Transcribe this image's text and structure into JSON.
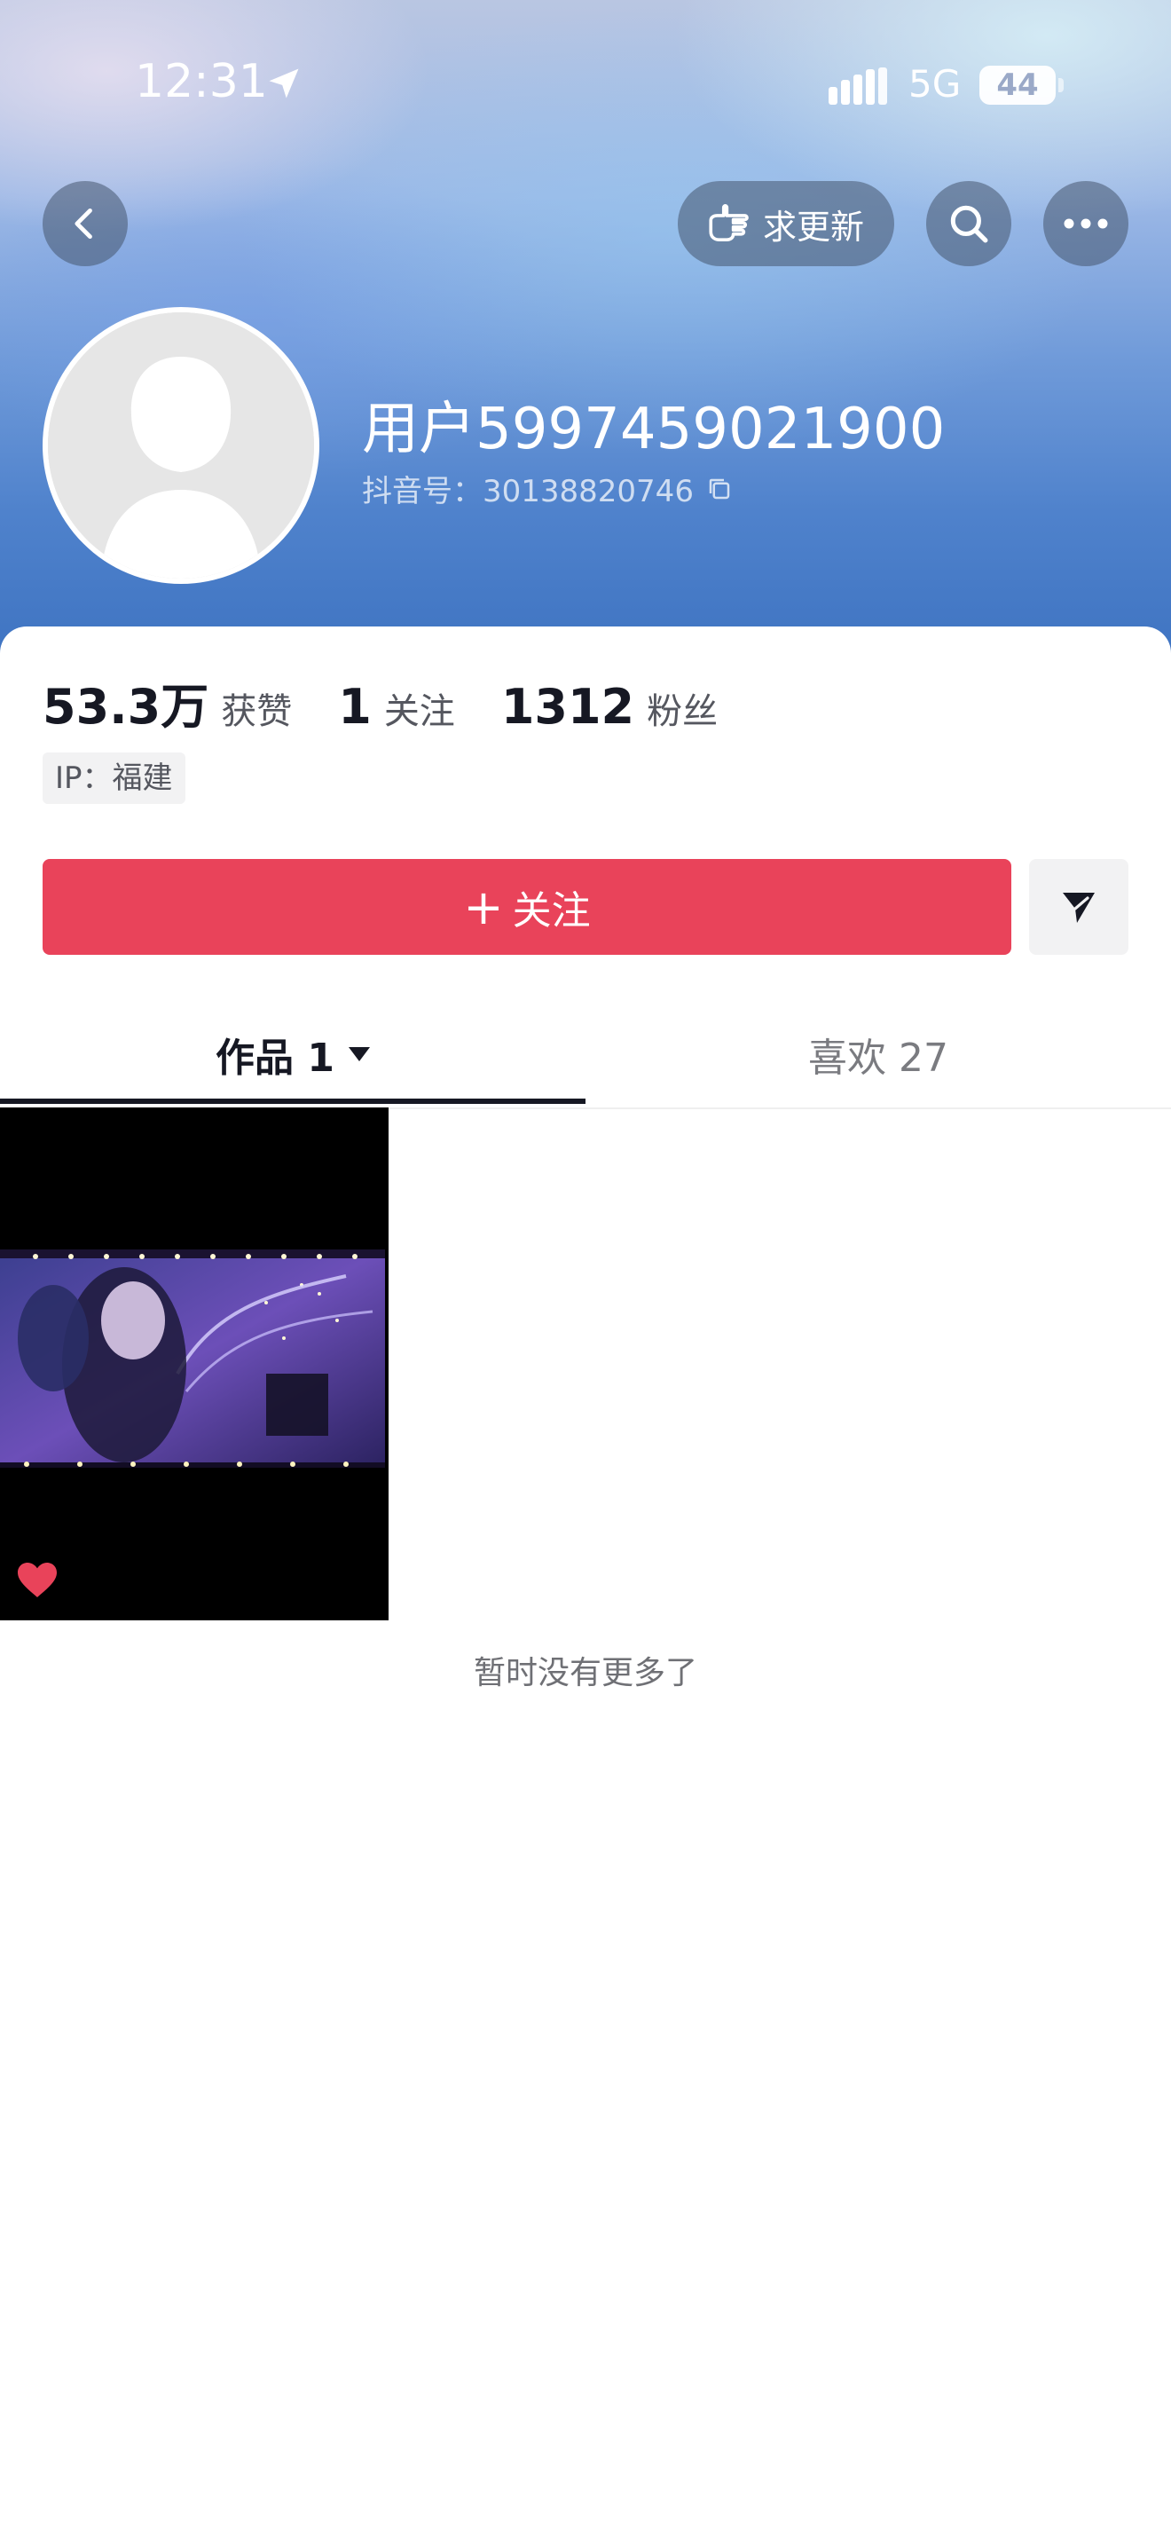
{
  "status_bar": {
    "time": "12:31",
    "network": "5G",
    "battery": "44"
  },
  "header": {
    "update_label": "求更新",
    "username": "用户5997459021900",
    "douyin_id": "抖音号：30138820746"
  },
  "stats": [
    {
      "value": "53.3万",
      "label": "获赞"
    },
    {
      "value": "1",
      "label": "关注"
    },
    {
      "value": "1312",
      "label": "粉丝"
    }
  ],
  "ip_tag": "IP：福建",
  "follow_button": {
    "plus": "+",
    "label": "关注"
  },
  "tabs": {
    "works": "作品 1",
    "likes": "喜欢 27"
  },
  "footer_text": "暂时没有更多了",
  "colors": {
    "accent": "#e9435a",
    "text_primary": "#161823",
    "text_secondary": "#55575f"
  }
}
